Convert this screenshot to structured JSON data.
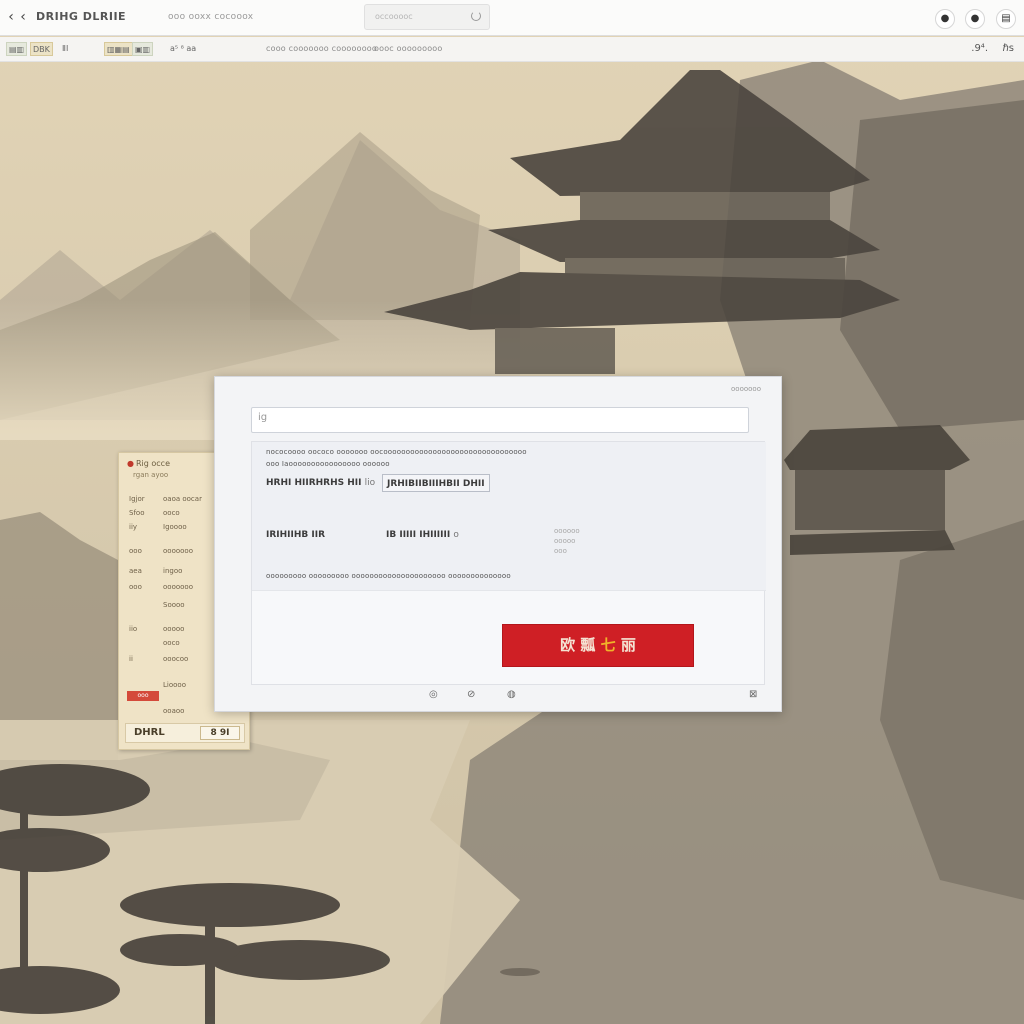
{
  "browser": {
    "back_glyph": "‹",
    "forward_glyph": "‹",
    "app_title": "DRIHG DLRIIE",
    "url_text": "ooo ooxx cocooox",
    "search_placeholder": "occooooc",
    "tool_buttons": [
      "●",
      "●",
      "▤"
    ]
  },
  "toolbar": {
    "chip_a": "▤▥",
    "chip_b": "DBK",
    "chip_c": "ⅡⅠ",
    "chip_d": "▥▦▤",
    "chip_e": "▣▥",
    "chip_f": "a⁵ ⁸ aa",
    "bookmark_1": "cooo cooooooo coooooooo",
    "bookmark_2": "oooc ooooooooo",
    "zoom": ".9⁴.",
    "end_icon": "ℏs"
  },
  "side_panel": {
    "heading": "Rig occe",
    "subheading": "rgan   ayoo",
    "rows": [
      {
        "k": "Igjor",
        "v": "oaoa oocar"
      },
      {
        "k": "Sfoo",
        "v": "ooco"
      },
      {
        "k": "iiy",
        "v": "Igoooo"
      },
      {
        "k": "ooo",
        "v": "ooooooo"
      },
      {
        "k": "aea",
        "v": "ingoo"
      },
      {
        "k": "ooo",
        "v": "ooooooo"
      },
      {
        "k": "",
        "v": "Soooo"
      },
      {
        "k": "iio",
        "v": "ooooo"
      },
      {
        "k": "",
        "v": "ooco"
      },
      {
        "k": "ii",
        "v": "ooocoo"
      },
      {
        "k": "",
        "v": "Lioooo"
      },
      {
        "k": "",
        "v": "ooaoo"
      }
    ],
    "red_tag": "ooo",
    "footer_text": "DHRL",
    "footer_button": "8 9I"
  },
  "dialog": {
    "title": "ooooooo",
    "input_value": "ig",
    "info_line_1": "nococoooo oococo ooooooo oocoooooooooooooooooooooooooooooooo",
    "info_line_2": "ooo  Iaoooooooooooooooo oooooo",
    "field_1": "HRHI  HIIRHRHS HII",
    "field_1b": "lio",
    "field_2": "JRHIBIIBIIIHBII DHII",
    "field_3": "IRIHIIHB IIR",
    "field_4": "IB IIIII IHIIIIII",
    "field_4b": "o",
    "side_note": [
      "oooooo",
      "ooooo",
      "ooo"
    ],
    "info_line_3": "ooooooooo ooooooooo ooooooooooooooooooooo oooooooooooooo",
    "confirm_left": "欧 瓢",
    "confirm_mid": "七",
    "confirm_right": "丽",
    "footer_icons": [
      "◎",
      "⊘",
      "◍",
      "⊠"
    ]
  },
  "colors": {
    "accent_red": "#cf1f25",
    "paper": "#d9cdb4"
  }
}
